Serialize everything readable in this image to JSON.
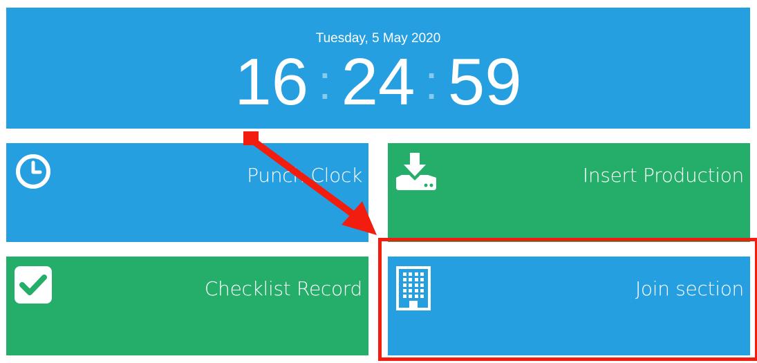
{
  "clock": {
    "date": "Tuesday, 5 May 2020",
    "hours": "16",
    "minutes": "24",
    "seconds": "59",
    "separator": ":"
  },
  "tiles": [
    {
      "label": "Punch Clock",
      "icon": "clock-icon",
      "color": "#259fe0"
    },
    {
      "label": "Insert Production",
      "icon": "download-tray-icon",
      "color": "#25ae6a"
    },
    {
      "label": "Checklist Record",
      "icon": "checkbox-icon",
      "color": "#25ae6a"
    },
    {
      "label": "Join section",
      "icon": "building-icon",
      "color": "#259fe0"
    }
  ],
  "annotation": {
    "arrow_color": "#f21d0e",
    "highlight_color": "#f21d0e"
  }
}
